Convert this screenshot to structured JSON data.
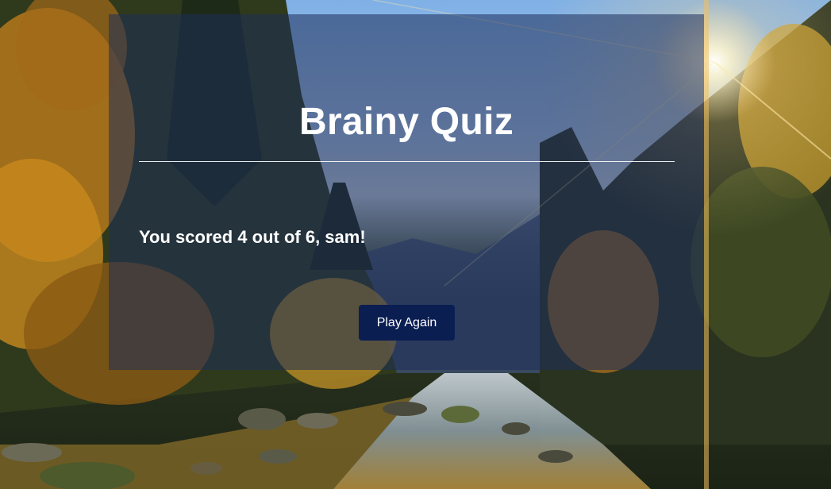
{
  "app": {
    "title": "Brainy Quiz"
  },
  "result": {
    "message": "You scored 4 out of 6, sam!"
  },
  "actions": {
    "play_again_label": "Play Again"
  },
  "theme": {
    "card_overlay": "#1e2d5a",
    "button_bg": "#0b1e52",
    "text_color": "#ffffff"
  }
}
